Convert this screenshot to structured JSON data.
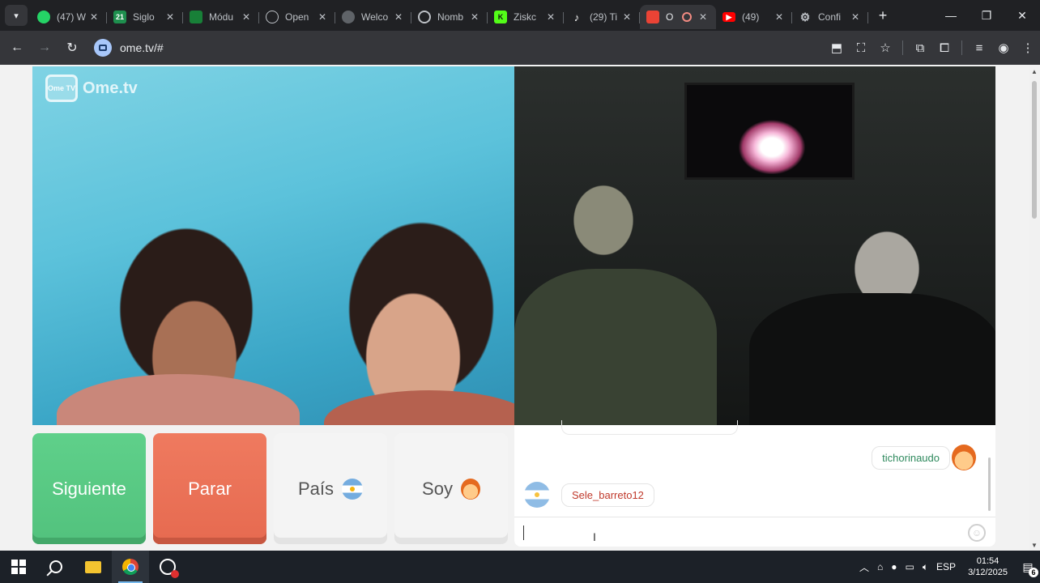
{
  "browser": {
    "tabs": [
      {
        "title": "(47) W",
        "icon": "whatsapp-icon",
        "color": "#25d366"
      },
      {
        "title": "Siglo",
        "icon": "siglo21-icon",
        "color": "#1e8f4e"
      },
      {
        "title": "Módu",
        "icon": "sheet-icon",
        "color": "#188038"
      },
      {
        "title": "Open",
        "icon": "openai-icon",
        "color": "#5f6368"
      },
      {
        "title": "Welco",
        "icon": "globe-icon",
        "color": "#5f6368"
      },
      {
        "title": "Nomb",
        "icon": "openai-icon",
        "color": "#5f6368"
      },
      {
        "title": "Ziskc",
        "icon": "kick-icon",
        "color": "#53fc18"
      },
      {
        "title": "(29) Ti",
        "icon": "tiktok-icon",
        "color": "#111111"
      },
      {
        "title": "O",
        "icon": "ometv-icon",
        "color": "#ea4335",
        "active": true
      },
      {
        "title": "(49)",
        "icon": "youtube-icon",
        "color": "#ff0000"
      },
      {
        "title": "Confi",
        "icon": "gear-icon",
        "color": "#9aa0a6"
      }
    ],
    "url": "ome.tv/#"
  },
  "app": {
    "logo_badge": "Ome TV",
    "logo_text": "Ome.tv",
    "buttons": {
      "next": "Siguiente",
      "stop": "Parar",
      "country": "País",
      "me": "Soy"
    }
  },
  "chat": {
    "messages": [
      {
        "side": "right",
        "user": "tichorinaudo",
        "color": "#2f8a5e"
      },
      {
        "side": "left",
        "user": "Sele_barreto12",
        "color": "#c0392b"
      }
    ],
    "input_value": ""
  },
  "taskbar": {
    "language": "ESP",
    "time": "01:54",
    "date": "3/12/2025",
    "notifications": "6"
  }
}
